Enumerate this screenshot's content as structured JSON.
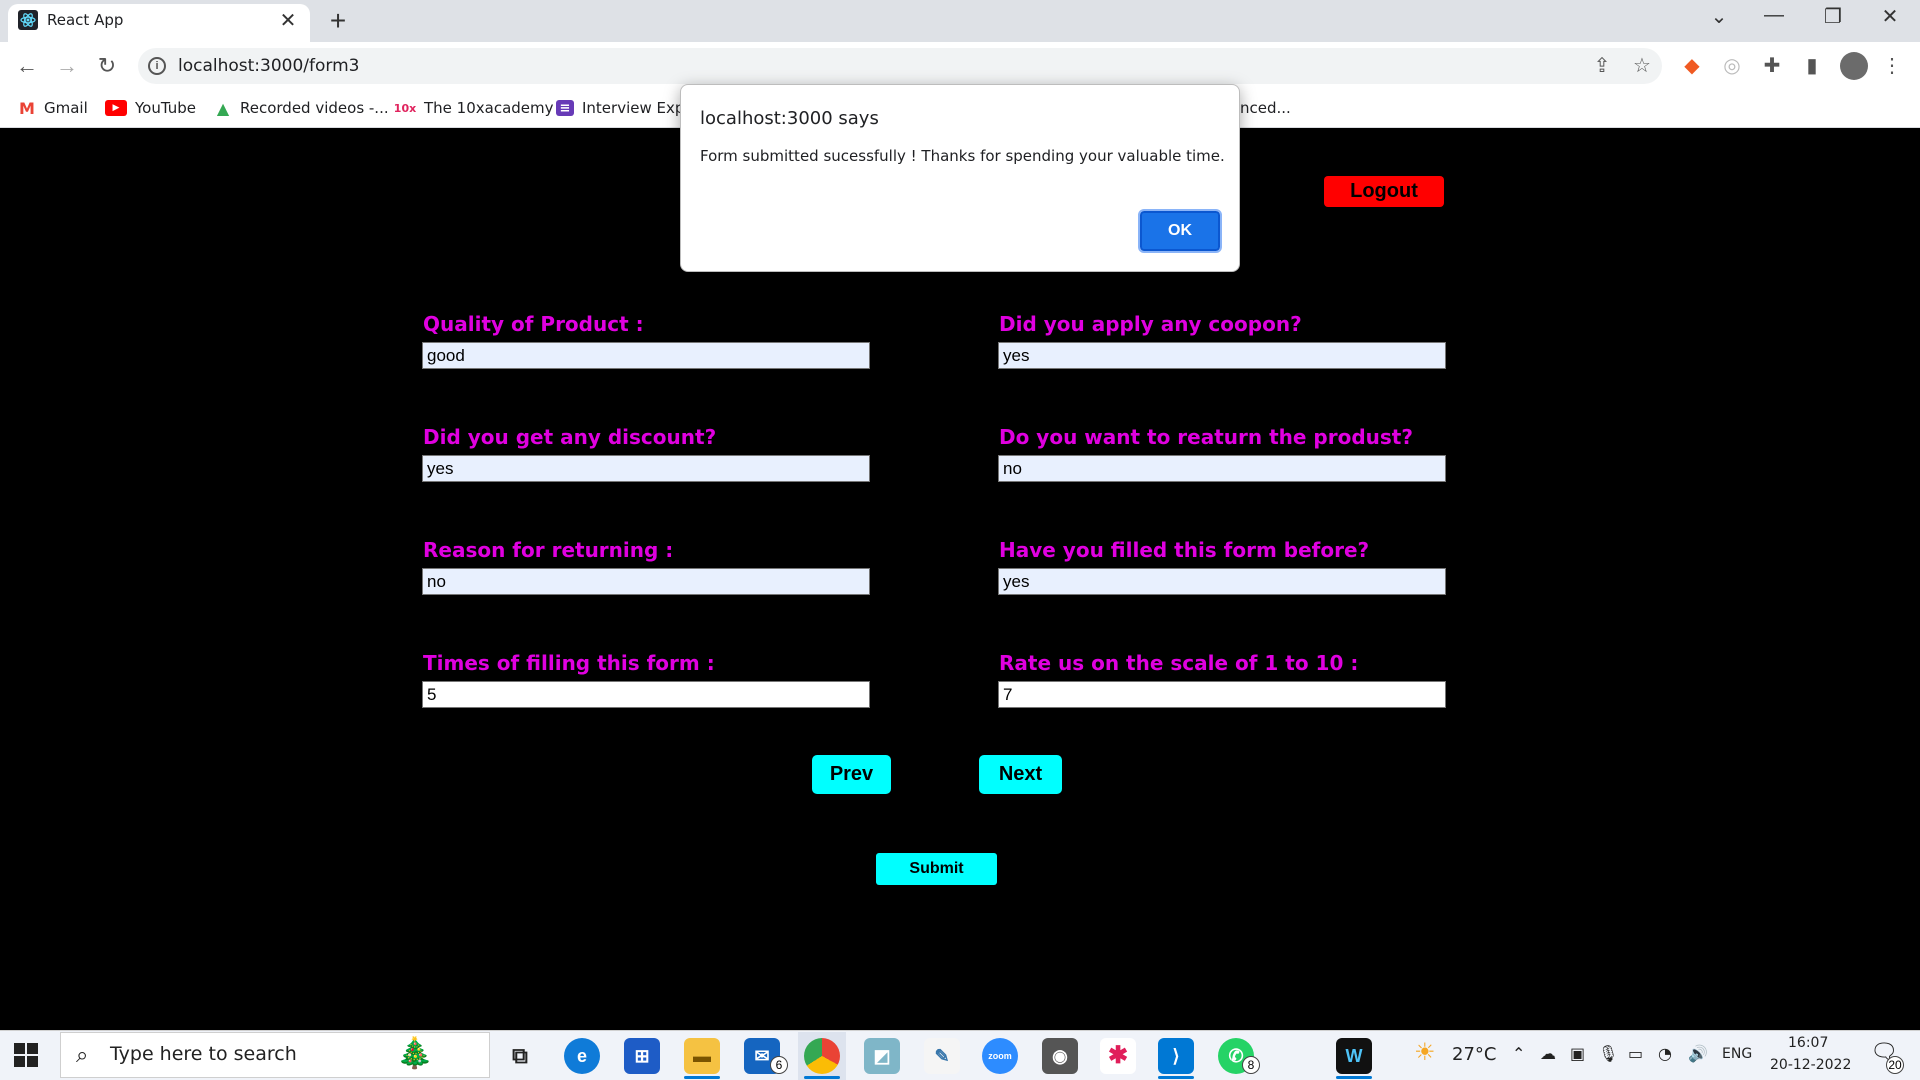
{
  "browser": {
    "tab_title": "React App",
    "tab_close": "✕",
    "new_tab": "+",
    "url": "localhost:3000/form3",
    "window_controls": [
      "⌄",
      "—",
      "❐",
      "✕"
    ],
    "bookmarks": [
      {
        "label": "Gmail",
        "icon": "gmail-icon",
        "glyph": "M",
        "color": "#ea4335"
      },
      {
        "label": "YouTube",
        "icon": "youtube-icon",
        "glyph": "▶",
        "color": "#ff0000"
      },
      {
        "label": "Recorded videos -...",
        "icon": "drive-icon",
        "glyph": "▲",
        "color": "#34a853"
      },
      {
        "label": "The 10xacademy",
        "icon": "10x-icon",
        "glyph": "10x",
        "color": "#e0245e"
      },
      {
        "label": "Interview Expe",
        "icon": "forms-icon",
        "glyph": "≡",
        "color": "#673ab7"
      }
    ],
    "bookmark_overflow": "nced..."
  },
  "dialog": {
    "title": "localhost:3000 says",
    "message": "Form submitted sucessfully ! Thanks for spending your valuable time.",
    "ok_label": "OK"
  },
  "page": {
    "logout_label": "Logout",
    "fields": [
      {
        "label": "Quality of Product :",
        "value": "good"
      },
      {
        "label": "Did you apply any coopon?",
        "value": "yes"
      },
      {
        "label": "Did you get any discount?",
        "value": "yes"
      },
      {
        "label": "Do you want to reaturn the produst?",
        "value": "no"
      },
      {
        "label": "Reason for returning :",
        "value": "no"
      },
      {
        "label": "Have you filled this form before?",
        "value": "yes"
      },
      {
        "label": "Times of filling this form :",
        "value": "5"
      },
      {
        "label": "Rate us on the scale of 1 to 10 :",
        "value": "7"
      }
    ],
    "prev_label": "Prev",
    "next_label": "Next",
    "submit_label": "Submit"
  },
  "taskbar": {
    "search_placeholder": "Type here to search",
    "mail_badge": "6",
    "whatsapp_badge": "8",
    "weather": "27°C",
    "language": "ENG",
    "time": "16:07",
    "date": "20-12-2022",
    "notification_count": "20"
  },
  "colors": {
    "label_magenta": "#e000e0",
    "button_cyan": "#00ffff",
    "logout_red": "#ff0000",
    "dialog_ok_blue": "#1a73e8"
  }
}
